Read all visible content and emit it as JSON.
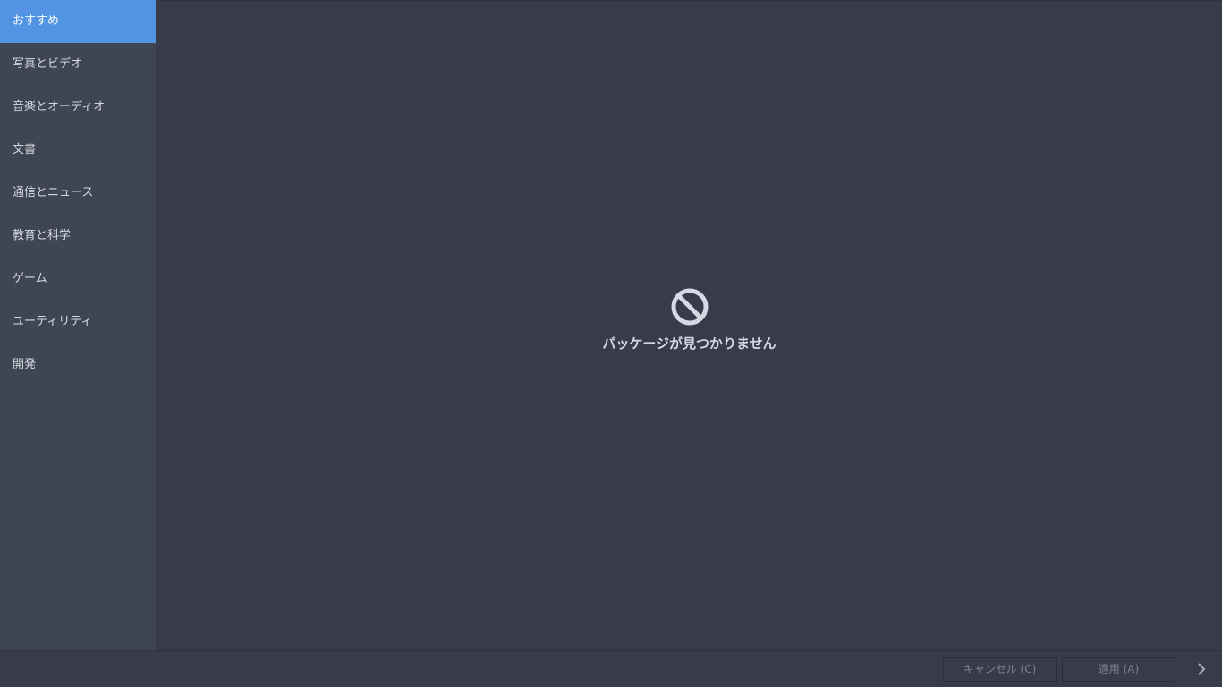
{
  "sidebar": {
    "items": [
      {
        "label": "おすすめ",
        "selected": true
      },
      {
        "label": "写真とビデオ",
        "selected": false
      },
      {
        "label": "音楽とオーディオ",
        "selected": false
      },
      {
        "label": "文書",
        "selected": false
      },
      {
        "label": "通信とニュース",
        "selected": false
      },
      {
        "label": "教育と科学",
        "selected": false
      },
      {
        "label": "ゲーム",
        "selected": false
      },
      {
        "label": "ユーティリティ",
        "selected": false
      },
      {
        "label": "開発",
        "selected": false
      }
    ]
  },
  "main": {
    "empty_icon": "no-entry-icon",
    "empty_message": "パッケージが見つかりません"
  },
  "footer": {
    "cancel_label": "キャンセル (C)",
    "apply_label": "適用 (A)",
    "next_icon": "chevron-right-icon"
  },
  "colors": {
    "accent": "#5294e2",
    "sidebar_bg": "#404552",
    "content_bg": "#383c4a",
    "text": "#d3dae3",
    "disabled_text": "#7c818c"
  }
}
